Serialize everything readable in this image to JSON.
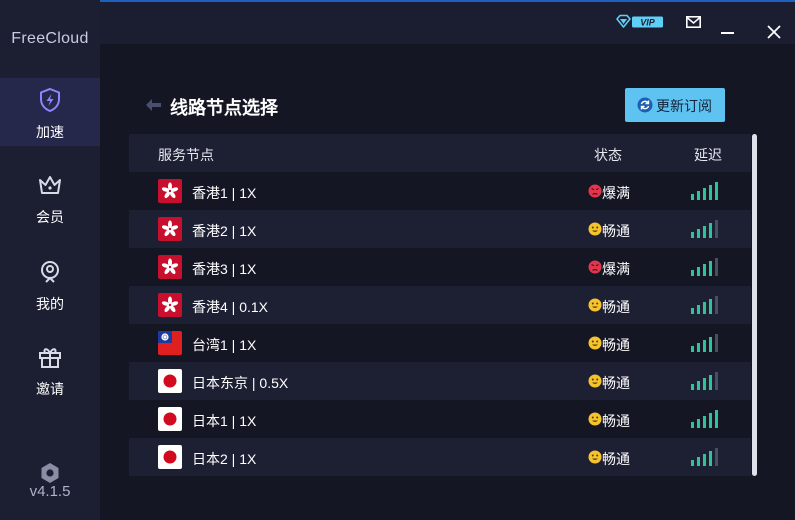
{
  "app": {
    "brand": "FreeCloud",
    "version": "v4.1.5"
  },
  "sidebar": {
    "items": [
      {
        "label": "加速",
        "icon": "lightning-shield-icon",
        "active": true
      },
      {
        "label": "会员",
        "icon": "crown-icon",
        "active": false
      },
      {
        "label": "我的",
        "icon": "user-badge-icon",
        "active": false
      },
      {
        "label": "邀请",
        "icon": "gift-icon",
        "active": false
      }
    ],
    "footer_icon": "gear-icon"
  },
  "titlebar": {
    "vip_label": "VIP",
    "icons": [
      "diamond-vip-icon",
      "mail-icon",
      "minimize-icon",
      "close-icon"
    ]
  },
  "main": {
    "title": "线路节点选择",
    "update_button": "更新订阅",
    "columns": {
      "node": "服务节点",
      "status": "状态",
      "latency": "延迟"
    },
    "rows": [
      {
        "flag": "hong-kong",
        "name": "香港1 | 1X",
        "status": "爆满",
        "status_type": "full",
        "signal_bars": 5
      },
      {
        "flag": "hong-kong",
        "name": "香港2 | 1X",
        "status": "畅通",
        "status_type": "smooth",
        "signal_bars": 4
      },
      {
        "flag": "hong-kong",
        "name": "香港3 | 1X",
        "status": "爆满",
        "status_type": "full",
        "signal_bars": 4
      },
      {
        "flag": "hong-kong",
        "name": "香港4 | 0.1X",
        "status": "畅通",
        "status_type": "smooth",
        "signal_bars": 4
      },
      {
        "flag": "taiwan",
        "name": "台湾1 | 1X",
        "status": "畅通",
        "status_type": "smooth",
        "signal_bars": 4
      },
      {
        "flag": "japan",
        "name": "日本东京 | 0.5X",
        "status": "畅通",
        "status_type": "smooth",
        "signal_bars": 4
      },
      {
        "flag": "japan",
        "name": "日本1 | 1X",
        "status": "畅通",
        "status_type": "smooth",
        "signal_bars": 5
      },
      {
        "flag": "japan",
        "name": "日本2 | 1X",
        "status": "畅通",
        "status_type": "smooth",
        "signal_bars": 4
      }
    ]
  },
  "colors": {
    "accent_button": "#5fc3f2",
    "signal_on": "#2fc39a",
    "signal_off": "#4a4e62",
    "status_full": "#e2364f",
    "status_smooth": "#f5c42c",
    "active_nav": "#25284a"
  }
}
